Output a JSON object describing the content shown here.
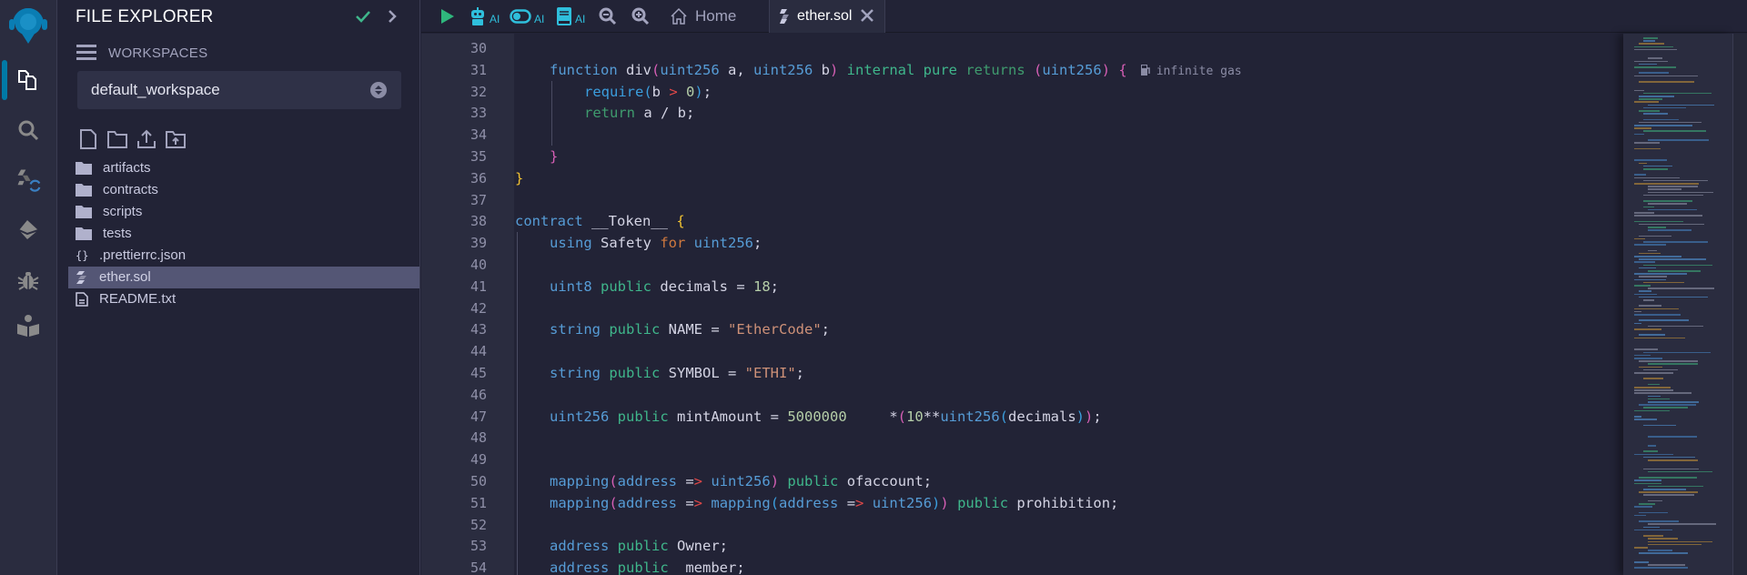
{
  "rail": {
    "items": [
      {
        "name": "file-explorer",
        "icon": "files-icon",
        "active": true
      },
      {
        "name": "search",
        "icon": "search-icon"
      },
      {
        "name": "solidity-compiler",
        "icon": "solidity-compile-icon"
      },
      {
        "name": "deploy-run",
        "icon": "ethereum-deploy-icon"
      },
      {
        "name": "debugger",
        "icon": "bug-icon"
      },
      {
        "name": "learneth",
        "icon": "book-reader-icon"
      }
    ]
  },
  "side": {
    "title": "FILE EXPLORER",
    "workspaces_label": "WORKSPACES",
    "workspace_selected": "default_workspace",
    "tree": [
      {
        "type": "folder",
        "label": "artifacts"
      },
      {
        "type": "folder",
        "label": "contracts"
      },
      {
        "type": "folder",
        "label": "scripts"
      },
      {
        "type": "folder",
        "label": "tests"
      },
      {
        "type": "json",
        "label": ".prettierrc.json"
      },
      {
        "type": "sol",
        "label": "ether.sol",
        "selected": true
      },
      {
        "type": "txt",
        "label": "README.txt"
      }
    ]
  },
  "topbar": {
    "ai_label": "AI",
    "home_tab": "Home",
    "active_tab": "ether.sol"
  },
  "editor": {
    "gas_hint": "infinite gas",
    "lines": [
      {
        "n": "30",
        "tokens": []
      },
      {
        "n": "31",
        "indent": 1,
        "tokens": [
          [
            "kw",
            "function"
          ],
          [
            "id",
            " div"
          ],
          [
            "pink",
            "("
          ],
          [
            "kw",
            "uint256"
          ],
          [
            "id",
            " a, "
          ],
          [
            "kw",
            "uint256"
          ],
          [
            "id",
            " b"
          ],
          [
            "pink",
            ")"
          ],
          [
            "id",
            " "
          ],
          [
            "grn",
            "internal"
          ],
          [
            "id",
            " "
          ],
          [
            "grn",
            "pure"
          ],
          [
            "id",
            " "
          ],
          [
            "ret",
            "returns"
          ],
          [
            "id",
            " "
          ],
          [
            "pink",
            "("
          ],
          [
            "kw",
            "uint256"
          ],
          [
            "pink",
            ")"
          ],
          [
            "id",
            " "
          ],
          [
            "pink",
            "{"
          ]
        ],
        "gas": true
      },
      {
        "n": "32",
        "indent": 2,
        "tokens": [
          [
            "blue2",
            "require"
          ],
          [
            "blue2",
            "("
          ],
          [
            "id",
            "b "
          ],
          [
            "red",
            ">"
          ],
          [
            "id",
            " "
          ],
          [
            "num",
            "0"
          ],
          [
            "blue2",
            ")"
          ],
          [
            "id",
            ";"
          ]
        ]
      },
      {
        "n": "33",
        "indent": 2,
        "tokens": [
          [
            "ret",
            "return"
          ],
          [
            "id",
            " a / b;"
          ]
        ]
      },
      {
        "n": "34",
        "tokens": []
      },
      {
        "n": "35",
        "indent": 1,
        "tokens": [
          [
            "pink",
            "}"
          ]
        ]
      },
      {
        "n": "36",
        "indent": 0,
        "tokens": [
          [
            "yel",
            "}"
          ]
        ]
      },
      {
        "n": "37",
        "tokens": []
      },
      {
        "n": "38",
        "indent": 0,
        "tokens": [
          [
            "kw",
            "contract"
          ],
          [
            "id",
            " __Token__ "
          ],
          [
            "yel",
            "{"
          ]
        ]
      },
      {
        "n": "39",
        "indent": 1,
        "tokens": [
          [
            "kw",
            "using"
          ],
          [
            "id",
            " Safety "
          ],
          [
            "for",
            "for"
          ],
          [
            "id",
            " "
          ],
          [
            "kw",
            "uint256"
          ],
          [
            "id",
            ";"
          ]
        ]
      },
      {
        "n": "40",
        "tokens": []
      },
      {
        "n": "41",
        "indent": 1,
        "tokens": [
          [
            "kw",
            "uint8"
          ],
          [
            "id",
            " "
          ],
          [
            "grn",
            "public"
          ],
          [
            "id",
            " decimals = "
          ],
          [
            "num",
            "18"
          ],
          [
            "id",
            ";"
          ]
        ]
      },
      {
        "n": "42",
        "tokens": []
      },
      {
        "n": "43",
        "indent": 1,
        "tokens": [
          [
            "kw",
            "string"
          ],
          [
            "id",
            " "
          ],
          [
            "grn",
            "public"
          ],
          [
            "id",
            " NAME = "
          ],
          [
            "str",
            "\"EtherCode\""
          ],
          [
            "id",
            ";"
          ]
        ]
      },
      {
        "n": "44",
        "tokens": []
      },
      {
        "n": "45",
        "indent": 1,
        "tokens": [
          [
            "kw",
            "string"
          ],
          [
            "id",
            " "
          ],
          [
            "grn",
            "public"
          ],
          [
            "id",
            " SYMBOL = "
          ],
          [
            "str",
            "\"ETHI\""
          ],
          [
            "id",
            ";"
          ]
        ]
      },
      {
        "n": "46",
        "tokens": []
      },
      {
        "n": "47",
        "indent": 1,
        "tokens": [
          [
            "kw",
            "uint256"
          ],
          [
            "id",
            " "
          ],
          [
            "grn",
            "public"
          ],
          [
            "id",
            " mintAmount = "
          ],
          [
            "num",
            "5000000"
          ],
          [
            "id",
            "     *"
          ],
          [
            "pink",
            "("
          ],
          [
            "num",
            "10"
          ],
          [
            "id",
            "**"
          ],
          [
            "kw",
            "uint256"
          ],
          [
            "blue2",
            "("
          ],
          [
            "id",
            "decimals"
          ],
          [
            "blue2",
            ")"
          ],
          [
            "pink",
            ")"
          ],
          [
            "id",
            ";"
          ]
        ]
      },
      {
        "n": "48",
        "tokens": []
      },
      {
        "n": "49",
        "tokens": []
      },
      {
        "n": "50",
        "indent": 1,
        "tokens": [
          [
            "kw",
            "mapping"
          ],
          [
            "pink",
            "("
          ],
          [
            "kw",
            "address"
          ],
          [
            "id",
            " ="
          ],
          [
            "red",
            ">"
          ],
          [
            "id",
            " "
          ],
          [
            "kw",
            "uint256"
          ],
          [
            "pink",
            ")"
          ],
          [
            "id",
            " "
          ],
          [
            "grn",
            "public"
          ],
          [
            "id",
            " ofaccount;"
          ]
        ]
      },
      {
        "n": "51",
        "indent": 1,
        "tokens": [
          [
            "kw",
            "mapping"
          ],
          [
            "pink",
            "("
          ],
          [
            "kw",
            "address"
          ],
          [
            "id",
            " ="
          ],
          [
            "red",
            ">"
          ],
          [
            "id",
            " "
          ],
          [
            "kw",
            "mapping"
          ],
          [
            "blue2",
            "("
          ],
          [
            "kw",
            "address"
          ],
          [
            "id",
            " ="
          ],
          [
            "red",
            ">"
          ],
          [
            "id",
            " "
          ],
          [
            "kw",
            "uint256"
          ],
          [
            "blue2",
            ")"
          ],
          [
            "pink",
            ")"
          ],
          [
            "id",
            " "
          ],
          [
            "grn",
            "public"
          ],
          [
            "id",
            " prohibition;"
          ]
        ]
      },
      {
        "n": "52",
        "tokens": []
      },
      {
        "n": "53",
        "indent": 1,
        "tokens": [
          [
            "kw",
            "address"
          ],
          [
            "id",
            " "
          ],
          [
            "grn",
            "public"
          ],
          [
            "id",
            " Owner;"
          ]
        ]
      },
      {
        "n": "54",
        "indent": 1,
        "tokens": [
          [
            "kw",
            "address"
          ],
          [
            "id",
            " "
          ],
          [
            "grn",
            "public"
          ],
          [
            "id",
            " _member;"
          ]
        ]
      }
    ]
  },
  "colors": {
    "accent": "#007aa6",
    "ai_icon": "#2fbfdc",
    "run_green": "#2fb67c",
    "check_green": "#3fb68b"
  }
}
